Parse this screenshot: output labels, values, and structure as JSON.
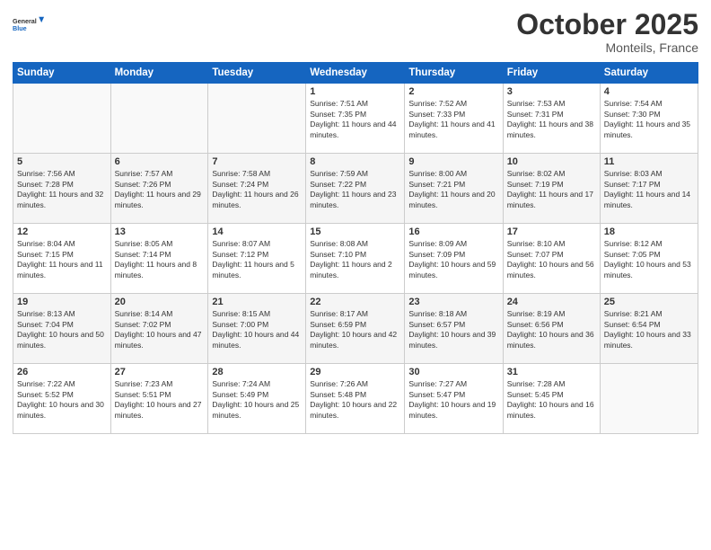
{
  "logo": {
    "line1": "General",
    "line2": "Blue"
  },
  "title": "October 2025",
  "location": "Monteils, France",
  "days_header": [
    "Sunday",
    "Monday",
    "Tuesday",
    "Wednesday",
    "Thursday",
    "Friday",
    "Saturday"
  ],
  "weeks": [
    [
      {
        "day": "",
        "info": ""
      },
      {
        "day": "",
        "info": ""
      },
      {
        "day": "",
        "info": ""
      },
      {
        "day": "1",
        "info": "Sunrise: 7:51 AM\nSunset: 7:35 PM\nDaylight: 11 hours and 44 minutes."
      },
      {
        "day": "2",
        "info": "Sunrise: 7:52 AM\nSunset: 7:33 PM\nDaylight: 11 hours and 41 minutes."
      },
      {
        "day": "3",
        "info": "Sunrise: 7:53 AM\nSunset: 7:31 PM\nDaylight: 11 hours and 38 minutes."
      },
      {
        "day": "4",
        "info": "Sunrise: 7:54 AM\nSunset: 7:30 PM\nDaylight: 11 hours and 35 minutes."
      }
    ],
    [
      {
        "day": "5",
        "info": "Sunrise: 7:56 AM\nSunset: 7:28 PM\nDaylight: 11 hours and 32 minutes."
      },
      {
        "day": "6",
        "info": "Sunrise: 7:57 AM\nSunset: 7:26 PM\nDaylight: 11 hours and 29 minutes."
      },
      {
        "day": "7",
        "info": "Sunrise: 7:58 AM\nSunset: 7:24 PM\nDaylight: 11 hours and 26 minutes."
      },
      {
        "day": "8",
        "info": "Sunrise: 7:59 AM\nSunset: 7:22 PM\nDaylight: 11 hours and 23 minutes."
      },
      {
        "day": "9",
        "info": "Sunrise: 8:00 AM\nSunset: 7:21 PM\nDaylight: 11 hours and 20 minutes."
      },
      {
        "day": "10",
        "info": "Sunrise: 8:02 AM\nSunset: 7:19 PM\nDaylight: 11 hours and 17 minutes."
      },
      {
        "day": "11",
        "info": "Sunrise: 8:03 AM\nSunset: 7:17 PM\nDaylight: 11 hours and 14 minutes."
      }
    ],
    [
      {
        "day": "12",
        "info": "Sunrise: 8:04 AM\nSunset: 7:15 PM\nDaylight: 11 hours and 11 minutes."
      },
      {
        "day": "13",
        "info": "Sunrise: 8:05 AM\nSunset: 7:14 PM\nDaylight: 11 hours and 8 minutes."
      },
      {
        "day": "14",
        "info": "Sunrise: 8:07 AM\nSunset: 7:12 PM\nDaylight: 11 hours and 5 minutes."
      },
      {
        "day": "15",
        "info": "Sunrise: 8:08 AM\nSunset: 7:10 PM\nDaylight: 11 hours and 2 minutes."
      },
      {
        "day": "16",
        "info": "Sunrise: 8:09 AM\nSunset: 7:09 PM\nDaylight: 10 hours and 59 minutes."
      },
      {
        "day": "17",
        "info": "Sunrise: 8:10 AM\nSunset: 7:07 PM\nDaylight: 10 hours and 56 minutes."
      },
      {
        "day": "18",
        "info": "Sunrise: 8:12 AM\nSunset: 7:05 PM\nDaylight: 10 hours and 53 minutes."
      }
    ],
    [
      {
        "day": "19",
        "info": "Sunrise: 8:13 AM\nSunset: 7:04 PM\nDaylight: 10 hours and 50 minutes."
      },
      {
        "day": "20",
        "info": "Sunrise: 8:14 AM\nSunset: 7:02 PM\nDaylight: 10 hours and 47 minutes."
      },
      {
        "day": "21",
        "info": "Sunrise: 8:15 AM\nSunset: 7:00 PM\nDaylight: 10 hours and 44 minutes."
      },
      {
        "day": "22",
        "info": "Sunrise: 8:17 AM\nSunset: 6:59 PM\nDaylight: 10 hours and 42 minutes."
      },
      {
        "day": "23",
        "info": "Sunrise: 8:18 AM\nSunset: 6:57 PM\nDaylight: 10 hours and 39 minutes."
      },
      {
        "day": "24",
        "info": "Sunrise: 8:19 AM\nSunset: 6:56 PM\nDaylight: 10 hours and 36 minutes."
      },
      {
        "day": "25",
        "info": "Sunrise: 8:21 AM\nSunset: 6:54 PM\nDaylight: 10 hours and 33 minutes."
      }
    ],
    [
      {
        "day": "26",
        "info": "Sunrise: 7:22 AM\nSunset: 5:52 PM\nDaylight: 10 hours and 30 minutes."
      },
      {
        "day": "27",
        "info": "Sunrise: 7:23 AM\nSunset: 5:51 PM\nDaylight: 10 hours and 27 minutes."
      },
      {
        "day": "28",
        "info": "Sunrise: 7:24 AM\nSunset: 5:49 PM\nDaylight: 10 hours and 25 minutes."
      },
      {
        "day": "29",
        "info": "Sunrise: 7:26 AM\nSunset: 5:48 PM\nDaylight: 10 hours and 22 minutes."
      },
      {
        "day": "30",
        "info": "Sunrise: 7:27 AM\nSunset: 5:47 PM\nDaylight: 10 hours and 19 minutes."
      },
      {
        "day": "31",
        "info": "Sunrise: 7:28 AM\nSunset: 5:45 PM\nDaylight: 10 hours and 16 minutes."
      },
      {
        "day": "",
        "info": ""
      }
    ]
  ]
}
